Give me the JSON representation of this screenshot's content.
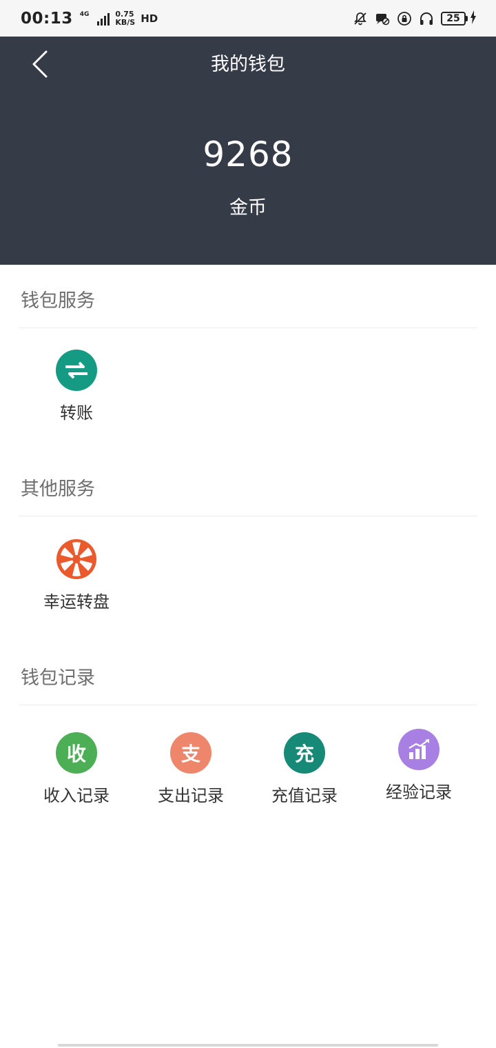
{
  "status_bar": {
    "time": "00:13",
    "network": "4G",
    "speed_value": "0.75",
    "speed_unit": "KB/S",
    "hd": "HD",
    "battery": "25"
  },
  "header": {
    "title": "我的钱包",
    "balance": "9268",
    "balance_unit": "金币"
  },
  "sections": {
    "wallet_services": {
      "title": "钱包服务",
      "items": [
        {
          "label": "转账",
          "icon": "transfer-icon",
          "color": "#159a84"
        }
      ]
    },
    "other_services": {
      "title": "其他服务",
      "items": [
        {
          "label": "幸运转盘",
          "icon": "wheel-icon",
          "color": "#ea5a2c"
        }
      ]
    },
    "wallet_records": {
      "title": "钱包记录",
      "items": [
        {
          "label": "收入记录",
          "glyph": "收",
          "color": "#4cae55"
        },
        {
          "label": "支出记录",
          "glyph": "支",
          "color": "#ee866c"
        },
        {
          "label": "充值记录",
          "glyph": "充",
          "color": "#168a76"
        },
        {
          "label": "经验记录",
          "icon": "chart-icon",
          "color": "#a880e4"
        }
      ]
    }
  },
  "colors": {
    "header_bg": "#363b48",
    "section_title": "#6e6e6e"
  }
}
